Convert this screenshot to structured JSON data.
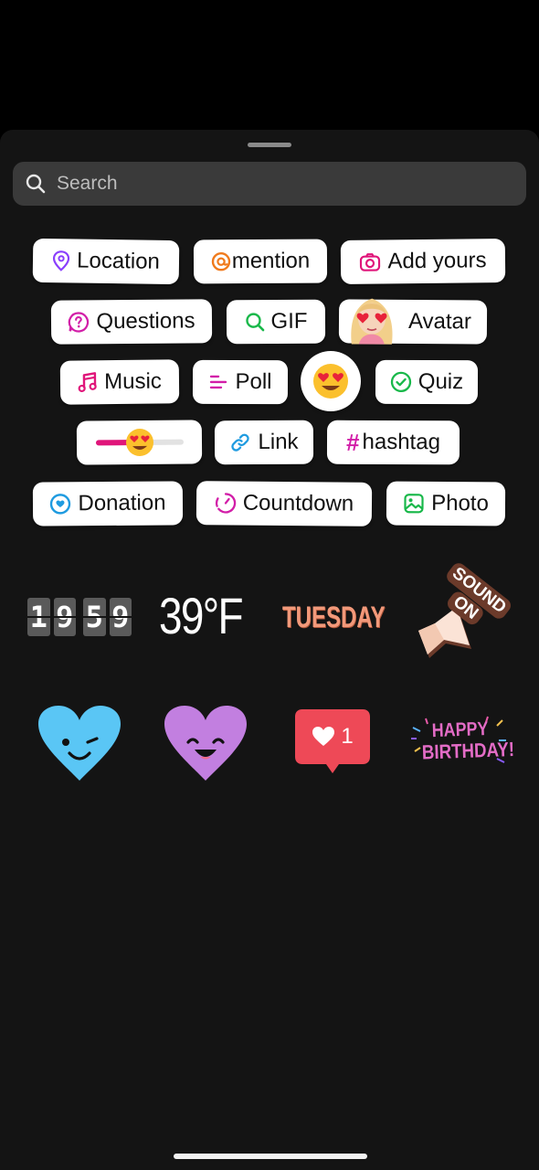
{
  "search": {
    "placeholder": "Search"
  },
  "chips": {
    "location": "Location",
    "mention": "mention",
    "add_yours": "Add yours",
    "questions": "Questions",
    "gif": "GIF",
    "avatar": "Avatar",
    "music": "Music",
    "poll": "Poll",
    "quiz": "Quiz",
    "link": "Link",
    "hashtag": "hashtag",
    "donation": "Donation",
    "countdown": "Countdown",
    "photo": "Photo"
  },
  "stickers": {
    "clock_digits": [
      "1",
      "9",
      "5",
      "9"
    ],
    "temperature": "39°F",
    "day": "TUESDAY",
    "sound_on_line1": "SOUND",
    "sound_on_line2": "ON",
    "like_count": "1",
    "birthday_line1": "HAPPY",
    "birthday_line2": "BIRTHDAY!"
  },
  "icons": {
    "location": "location-pin-icon",
    "mention": "threads-at-icon",
    "add_yours": "camera-icon",
    "questions": "question-bubble-icon",
    "gif": "search-icon",
    "music": "music-note-icon",
    "poll": "poll-lines-icon",
    "quiz": "check-circle-icon",
    "link": "link-icon",
    "hashtag": "hashtag-icon",
    "donation": "donation-heart-icon",
    "countdown": "countdown-timer-icon",
    "photo": "image-icon"
  },
  "colors": {
    "sheet_bg": "#141414",
    "search_bg": "#3a3a3a",
    "location": "#8a3ffc",
    "mention": "#f07a1c",
    "pink": "#e0157a",
    "green": "#19b84a",
    "blue": "#1f9be0",
    "magenta": "#d21ea8",
    "heart_blue": "#5ac6f5",
    "heart_purple": "#c27fe0",
    "like_red": "#ee4957",
    "day_orange": "#f2997a"
  }
}
